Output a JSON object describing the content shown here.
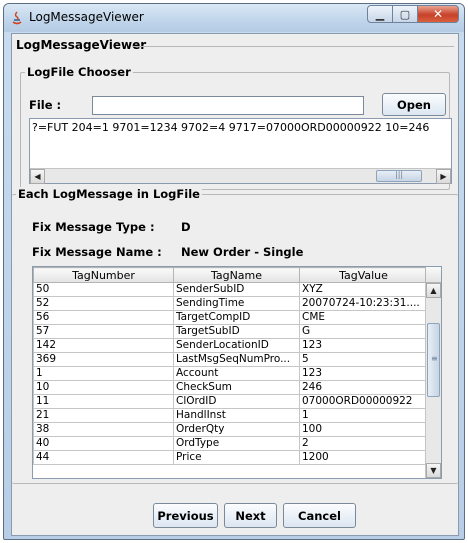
{
  "window": {
    "title": "LogMessageViewer"
  },
  "panel": {
    "title": "LogMessageViewer"
  },
  "chooser": {
    "group_title": "LogFile Chooser",
    "file_label": "File :",
    "file_value": "",
    "open_label": "Open",
    "log_text": "?=FUT 204=1 9701=1234 9702=4 9717=07000ORD00000922 10=246"
  },
  "message": {
    "group_title": "Each LogMessage in LogFile",
    "type_label": "Fix Message Type :",
    "type_value": "D",
    "name_label": "Fix Message Name :",
    "name_value": "New Order - Single"
  },
  "table": {
    "columns": [
      "TagNumber",
      "TagName",
      "TagValue"
    ],
    "rows": [
      [
        "50",
        "SenderSubID",
        "XYZ"
      ],
      [
        "52",
        "SendingTime",
        "20070724-10:23:31...."
      ],
      [
        "56",
        "TargetCompID",
        "CME"
      ],
      [
        "57",
        "TargetSubID",
        "G"
      ],
      [
        "142",
        "SenderLocationID",
        "123"
      ],
      [
        "369",
        "LastMsgSeqNumPro...",
        "5"
      ],
      [
        "1",
        "Account",
        "123"
      ],
      [
        "10",
        "CheckSum",
        "246"
      ],
      [
        "11",
        "ClOrdID",
        "07000ORD00000922"
      ],
      [
        "21",
        "HandlInst",
        "1"
      ],
      [
        "38",
        "OrderQty",
        "100"
      ],
      [
        "40",
        "OrdType",
        "2"
      ],
      [
        "44",
        "Price",
        "1200"
      ]
    ]
  },
  "buttons": {
    "previous": "Previous",
    "next": "Next",
    "cancel": "Cancel"
  }
}
